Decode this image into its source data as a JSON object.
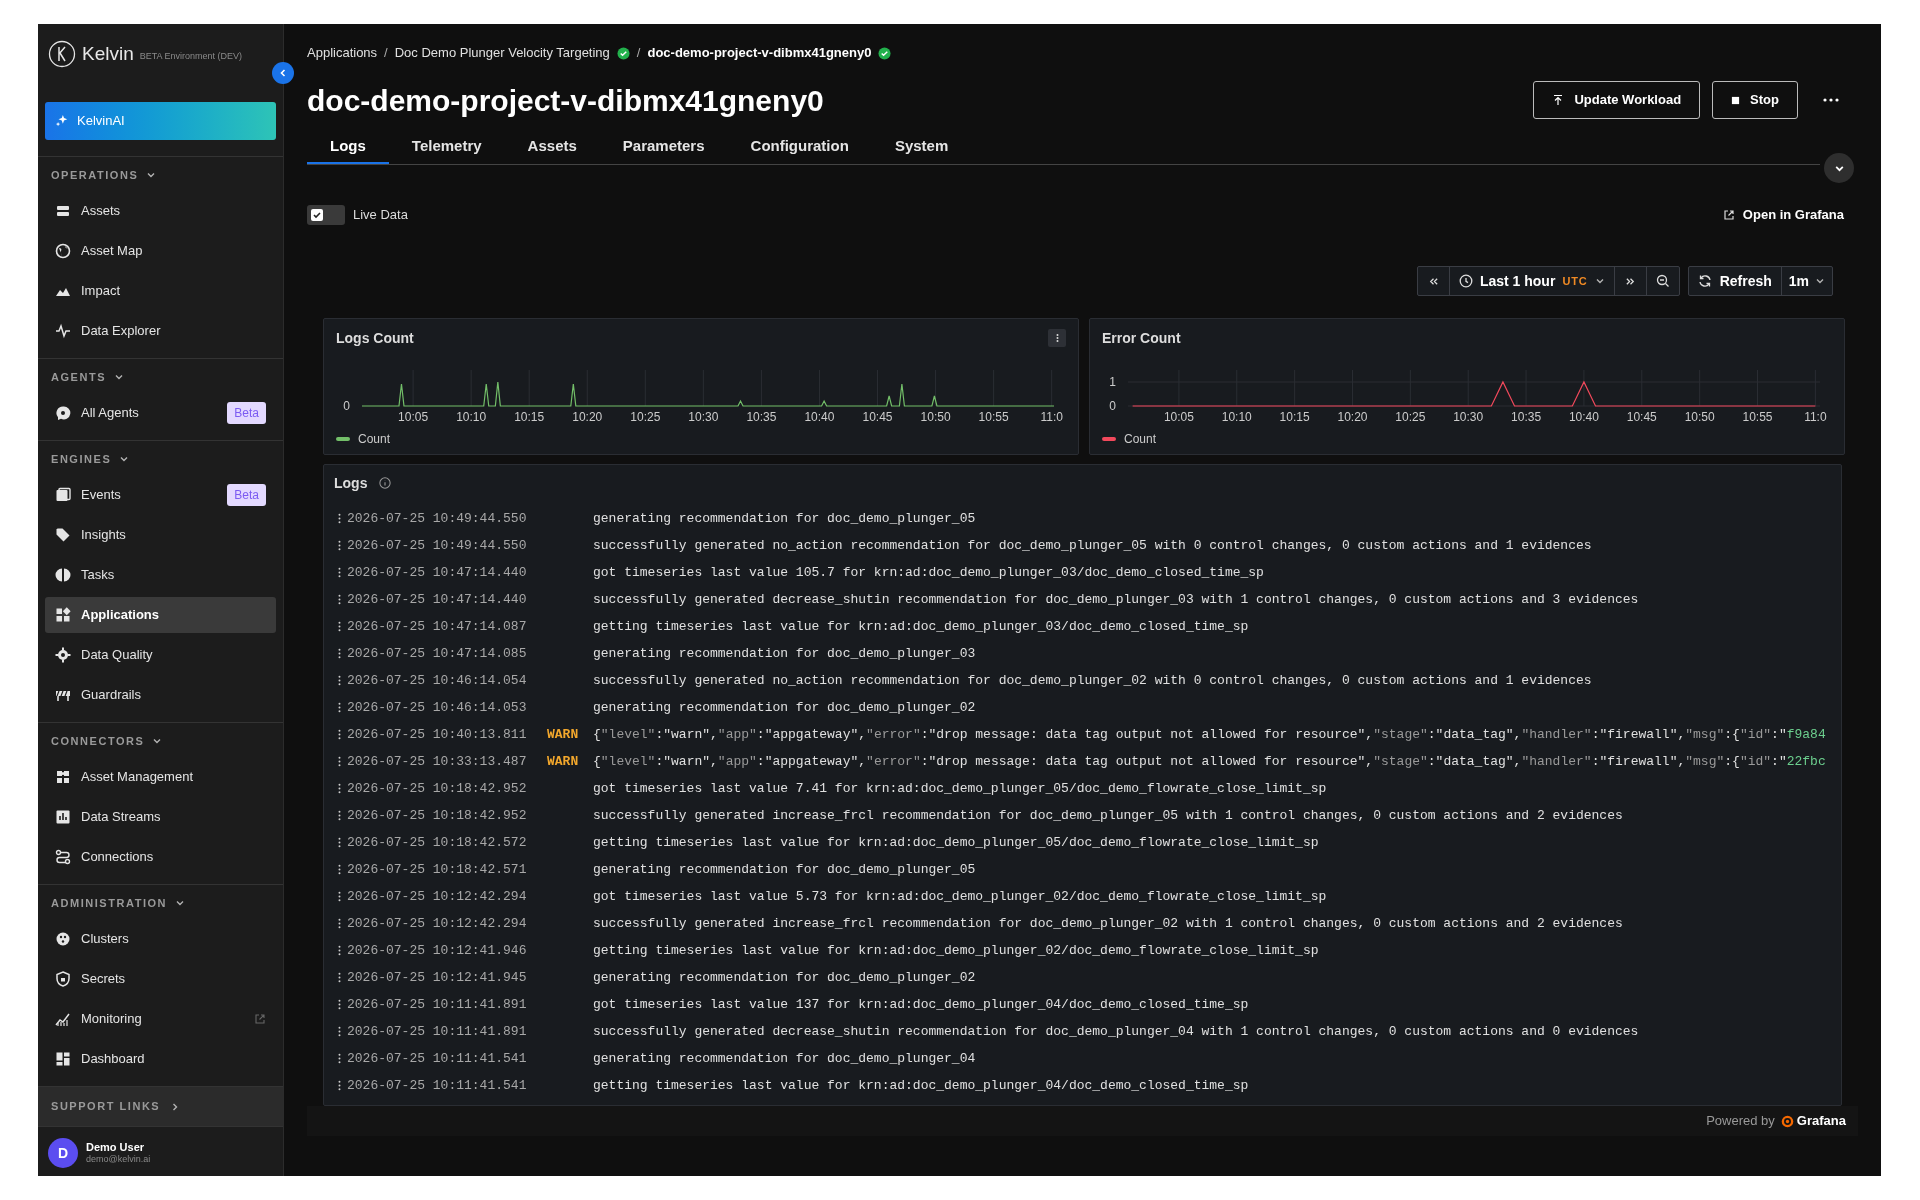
{
  "sidebar": {
    "logo": "Kelvin",
    "environment": "BETA Environment (DEV)",
    "ai_button": "KelvinAI",
    "sections": [
      {
        "title": "OPERATIONS",
        "expanded": true,
        "items": [
          {
            "label": "Assets",
            "selected": false,
            "kind": "page"
          },
          {
            "label": "Asset Map",
            "selected": false,
            "kind": "page"
          },
          {
            "label": "Impact",
            "selected": false,
            "kind": "page"
          },
          {
            "label": "Data Explorer",
            "selected": false,
            "kind": "page"
          }
        ]
      },
      {
        "title": "AGENTS",
        "expanded": true,
        "items": [
          {
            "label": "All Agents",
            "selected": false,
            "kind": "page",
            "badge": "Beta"
          }
        ]
      },
      {
        "title": "ENGINES",
        "expanded": true,
        "items": [
          {
            "label": "Events",
            "selected": false,
            "kind": "page",
            "badge": "Beta"
          },
          {
            "label": "Insights",
            "selected": false,
            "kind": "page"
          },
          {
            "label": "Tasks",
            "selected": false,
            "kind": "page"
          },
          {
            "label": "Applications",
            "selected": true,
            "kind": "page"
          },
          {
            "label": "Data Quality",
            "selected": false,
            "kind": "page"
          },
          {
            "label": "Guardrails",
            "selected": false,
            "kind": "page"
          }
        ]
      },
      {
        "title": "CONNECTORS",
        "expanded": true,
        "items": [
          {
            "label": "Asset Management",
            "selected": false,
            "kind": "page"
          },
          {
            "label": "Data Streams",
            "selected": false,
            "kind": "page"
          },
          {
            "label": "Connections",
            "selected": false,
            "kind": "page"
          }
        ]
      },
      {
        "title": "ADMINISTRATION",
        "expanded": true,
        "items": [
          {
            "label": "Clusters",
            "selected": false,
            "kind": "page"
          },
          {
            "label": "Secrets",
            "selected": false,
            "kind": "page"
          },
          {
            "label": "Monitoring",
            "selected": false,
            "kind": "external"
          },
          {
            "label": "Dashboard",
            "selected": false,
            "kind": "page"
          }
        ]
      }
    ],
    "support_links": {
      "title": "SUPPORT LINKS",
      "expanded": false
    },
    "user": {
      "initial": "D",
      "name": "Demo User",
      "email": "demo@kelvin.ai"
    }
  },
  "breadcrumb": [
    {
      "label": "Applications",
      "current": false,
      "verified": false
    },
    {
      "separator": "/",
      "label": "Doc Demo Plunger Velocity Targeting",
      "current": false,
      "verified": true
    },
    {
      "separator": "/",
      "label": "doc-demo-project-v-dibmx41gneny0",
      "current": true,
      "verified": true
    }
  ],
  "title": "doc-demo-project-v-dibmx41gneny0",
  "actions": [
    "Update Workload",
    "Stop"
  ],
  "tabs": [
    {
      "label": "Logs",
      "selected": true
    },
    {
      "label": "Telemetry",
      "selected": false
    },
    {
      "label": "Assets",
      "selected": false
    },
    {
      "label": "Parameters",
      "selected": false
    },
    {
      "label": "Configuration",
      "selected": false
    },
    {
      "label": "System",
      "selected": false
    }
  ],
  "live_data": {
    "label": "Live Data",
    "checked": true
  },
  "open_link": "Open in Grafana",
  "time_picker": {
    "range": "Last 1 hour",
    "timezone": "UTC"
  },
  "refresh": {
    "label": "Refresh",
    "interval": "1m"
  },
  "logs_count": {
    "title": "Logs Count",
    "y_tick": "0",
    "x_ticks": [
      "10:05",
      "10:10",
      "10:15",
      "10:20",
      "10:25",
      "10:30",
      "10:35",
      "10:40",
      "10:45",
      "10:50",
      "10:55",
      "11:0"
    ],
    "legend": "Count"
  },
  "error_count": {
    "chart_data": {
      "type": "line",
      "title": "Error Count",
      "categories": [
        null,
        null,
        null,
        null,
        "10:05",
        null,
        null,
        null,
        null,
        "10:10",
        null,
        null,
        null,
        null,
        "10:15",
        null,
        null,
        null,
        null,
        "10:20",
        null,
        null,
        null,
        null,
        "10:25",
        null,
        null,
        null,
        null,
        "10:30",
        null,
        null,
        null,
        null,
        "10:35",
        null,
        null,
        null,
        null,
        "10:40",
        null,
        null,
        null,
        null,
        "10:45",
        null,
        null,
        null,
        null,
        "10:50",
        null,
        null,
        null,
        null,
        "10:55",
        null,
        null,
        null,
        null,
        "11:0"
      ],
      "series": [
        {
          "name": "Count",
          "color": "#f2495c",
          "values": [
            0,
            0,
            0,
            0,
            0,
            0,
            0,
            0,
            0,
            0,
            0,
            0,
            0,
            0,
            0,
            0,
            0,
            0,
            0,
            0,
            0,
            0,
            0,
            0,
            0,
            0,
            0,
            0,
            0,
            0,
            0,
            0,
            1,
            0,
            0,
            0,
            0,
            0,
            0,
            1,
            0,
            0,
            0,
            0,
            0,
            0,
            0,
            0,
            0,
            0,
            0,
            0,
            0,
            0,
            0,
            0,
            0,
            0,
            0,
            0
          ]
        }
      ],
      "ylim": [
        0,
        1
      ],
      "yticks": [
        0,
        1
      ],
      "grid": true
    }
  },
  "logs": {
    "title": "Logs",
    "rows": [
      {
        "time": "2026-07-25 10:49:44.550",
        "kind": "info",
        "message": "generating recommendation for doc_demo_plunger_05"
      },
      {
        "time": "2026-07-25 10:49:44.550",
        "kind": "info",
        "message": "successfully generated no_action recommendation for doc_demo_plunger_05 with 0 control changes, 0 custom actions and 1 evidences"
      },
      {
        "time": "2026-07-25 10:47:14.440",
        "kind": "info",
        "message": "got timeseries last value 105.7 for krn:ad:doc_demo_plunger_03/doc_demo_closed_time_sp"
      },
      {
        "time": "2026-07-25 10:47:14.440",
        "kind": "info",
        "message": "successfully generated decrease_shutin recommendation for doc_demo_plunger_03 with 1 control changes, 0 custom actions and 3 evidences"
      },
      {
        "time": "2026-07-25 10:47:14.087",
        "kind": "info",
        "message": "getting timeseries last value for krn:ad:doc_demo_plunger_03/doc_demo_closed_time_sp"
      },
      {
        "time": "2026-07-25 10:47:14.085",
        "kind": "info",
        "message": "generating recommendation for doc_demo_plunger_03"
      },
      {
        "time": "2026-07-25 10:46:14.054",
        "kind": "info",
        "message": "successfully generated no_action recommendation for doc_demo_plunger_02 with 0 control changes, 0 custom actions and 1 evidences"
      },
      {
        "time": "2026-07-25 10:46:14.053",
        "kind": "info",
        "message": "generating recommendation for doc_demo_plunger_02"
      },
      {
        "time": "2026-07-25 10:40:13.811",
        "kind": "warn",
        "level": "WARN",
        "parts": [
          {
            "kind": "text",
            "text": "{"
          },
          {
            "kind": "key",
            "text": "\"level\""
          },
          {
            "kind": "text",
            "text": ":\"warn\","
          },
          {
            "kind": "key",
            "text": "\"app\""
          },
          {
            "kind": "text",
            "text": ":\"appgateway\","
          },
          {
            "kind": "key",
            "text": "\"error\""
          },
          {
            "kind": "text",
            "text": ":\"drop message: data tag output not allowed for resource\","
          },
          {
            "kind": "key",
            "text": "\"stage\""
          },
          {
            "kind": "text",
            "text": ":\"data_tag\","
          },
          {
            "kind": "key",
            "text": "\"handler\""
          },
          {
            "kind": "text",
            "text": ":\"firewall\","
          },
          {
            "kind": "key",
            "text": "\"msg\""
          },
          {
            "kind": "text",
            "text": ":{"
          },
          {
            "kind": "key",
            "text": "\"id\""
          },
          {
            "kind": "text",
            "text": ":\""
          },
          {
            "kind": "id",
            "text": "f9a84"
          }
        ]
      },
      {
        "time": "2026-07-25 10:33:13.487",
        "kind": "warn",
        "level": "WARN",
        "parts": [
          {
            "kind": "text",
            "text": "{"
          },
          {
            "kind": "key",
            "text": "\"level\""
          },
          {
            "kind": "text",
            "text": ":\"warn\","
          },
          {
            "kind": "key",
            "text": "\"app\""
          },
          {
            "kind": "text",
            "text": ":\"appgateway\","
          },
          {
            "kind": "key",
            "text": "\"error\""
          },
          {
            "kind": "text",
            "text": ":\"drop message: data tag output not allowed for resource\","
          },
          {
            "kind": "key",
            "text": "\"stage\""
          },
          {
            "kind": "text",
            "text": ":\"data_tag\","
          },
          {
            "kind": "key",
            "text": "\"handler\""
          },
          {
            "kind": "text",
            "text": ":\"firewall\","
          },
          {
            "kind": "key",
            "text": "\"msg\""
          },
          {
            "kind": "text",
            "text": ":{"
          },
          {
            "kind": "key",
            "text": "\"id\""
          },
          {
            "kind": "text",
            "text": ":\""
          },
          {
            "kind": "id",
            "text": "22fbc"
          }
        ]
      },
      {
        "time": "2026-07-25 10:18:42.952",
        "kind": "info",
        "message": "got timeseries last value 7.41 for krn:ad:doc_demo_plunger_05/doc_demo_flowrate_close_limit_sp"
      },
      {
        "time": "2026-07-25 10:18:42.952",
        "kind": "info",
        "message": "successfully generated increase_frcl recommendation for doc_demo_plunger_05 with 1 control changes, 0 custom actions and 2 evidences"
      },
      {
        "time": "2026-07-25 10:18:42.572",
        "kind": "info",
        "message": "getting timeseries last value for krn:ad:doc_demo_plunger_05/doc_demo_flowrate_close_limit_sp"
      },
      {
        "time": "2026-07-25 10:18:42.571",
        "kind": "info",
        "message": "generating recommendation for doc_demo_plunger_05"
      },
      {
        "time": "2026-07-25 10:12:42.294",
        "kind": "info",
        "message": "got timeseries last value 5.73 for krn:ad:doc_demo_plunger_02/doc_demo_flowrate_close_limit_sp"
      },
      {
        "time": "2026-07-25 10:12:42.294",
        "kind": "info",
        "message": "successfully generated increase_frcl recommendation for doc_demo_plunger_02 with 1 control changes, 0 custom actions and 2 evidences"
      },
      {
        "time": "2026-07-25 10:12:41.946",
        "kind": "info",
        "message": "getting timeseries last value for krn:ad:doc_demo_plunger_02/doc_demo_flowrate_close_limit_sp"
      },
      {
        "time": "2026-07-25 10:12:41.945",
        "kind": "info",
        "message": "generating recommendation for doc_demo_plunger_02"
      },
      {
        "time": "2026-07-25 10:11:41.891",
        "kind": "info",
        "message": "got timeseries last value 137 for krn:ad:doc_demo_plunger_04/doc_demo_closed_time_sp"
      },
      {
        "time": "2026-07-25 10:11:41.891",
        "kind": "info",
        "message": "successfully generated decrease_shutin recommendation for doc_demo_plunger_04 with 1 control changes, 0 custom actions and 0 evidences"
      },
      {
        "time": "2026-07-25 10:11:41.541",
        "kind": "info",
        "message": "generating recommendation for doc_demo_plunger_04"
      },
      {
        "time": "2026-07-25 10:11:41.541",
        "kind": "info",
        "message": "getting timeseries last value for krn:ad:doc_demo_plunger_04/doc_demo_closed_time_sp"
      }
    ]
  },
  "footer": {
    "powered_by": "Powered by",
    "brand": "Grafana"
  }
}
